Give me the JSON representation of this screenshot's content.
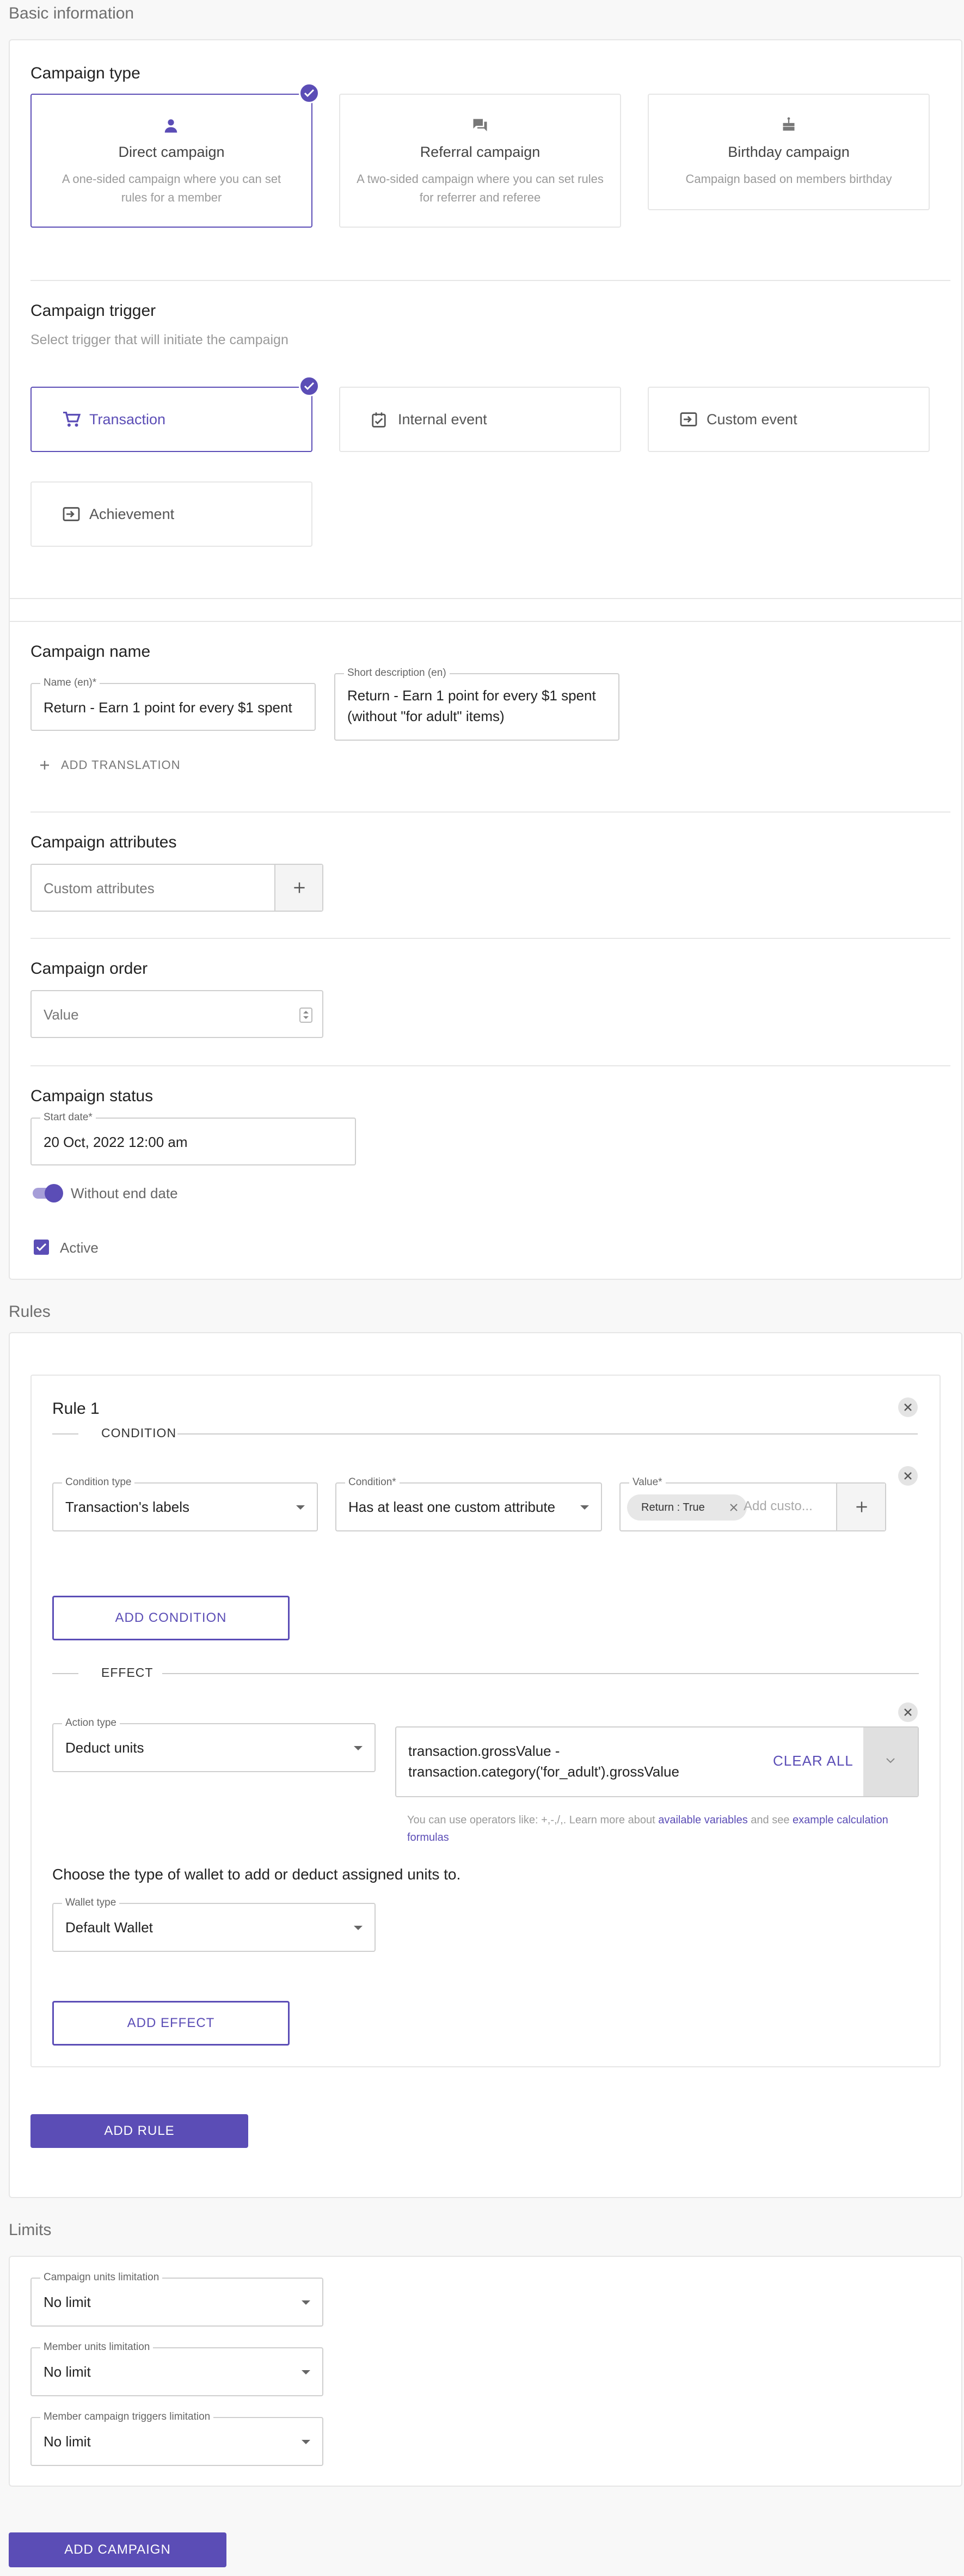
{
  "basic": {
    "section_title": "Basic information",
    "campaign_type": {
      "heading": "Campaign type",
      "options": [
        {
          "title": "Direct campaign",
          "desc": "A one-sided campaign where you can set rules for a member",
          "icon": "person-icon",
          "selected": true
        },
        {
          "title": "Referral campaign",
          "desc": "A two-sided campaign where you can set rules for referrer and referee",
          "icon": "chat-icon",
          "selected": false
        },
        {
          "title": "Birthday campaign",
          "desc": "Campaign based on members birthday",
          "icon": "cake-icon",
          "selected": false
        }
      ]
    },
    "campaign_trigger": {
      "heading": "Campaign trigger",
      "subtitle": "Select trigger that will initiate the campaign",
      "options": [
        {
          "label": "Transaction",
          "icon": "cart-icon",
          "selected": true
        },
        {
          "label": "Internal event",
          "icon": "calendar-check-icon",
          "selected": false
        },
        {
          "label": "Custom event",
          "icon": "input-icon",
          "selected": false
        },
        {
          "label": "Achievement",
          "icon": "input-icon",
          "selected": false
        }
      ]
    },
    "campaign_name": {
      "heading": "Campaign name",
      "name_label": "Name (en)*",
      "name_value": "Return - Earn 1 point for every $1 spent",
      "short_label": "Short description (en)",
      "short_value_line1": "Return - Earn 1 point for every $1 spent",
      "short_value_line2": "(without \"for adult\" items)",
      "add_translation": "ADD TRANSLATION"
    },
    "attributes": {
      "heading": "Campaign attributes",
      "placeholder": "Custom attributes"
    },
    "order": {
      "heading": "Campaign order",
      "placeholder": "Value"
    },
    "status": {
      "heading": "Campaign status",
      "start_label": "Start date*",
      "start_value": "20 Oct, 2022 12:00 am",
      "toggle_label": "Without end date",
      "toggle_on": true,
      "active_label": "Active",
      "active_checked": true
    }
  },
  "rules": {
    "section_title": "Rules",
    "rule": {
      "title": "Rule 1",
      "condition_heading": "CONDITION",
      "condition_type_label": "Condition type",
      "condition_type_value": "Transaction's labels",
      "condition_label": "Condition*",
      "condition_value": "Has at least one custom attribute",
      "value_label": "Value*",
      "value_chip": "Return : True",
      "value_placeholder": "Add custo...",
      "add_condition": "ADD CONDITION",
      "effect_heading": "EFFECT",
      "action_label": "Action type",
      "action_value": "Deduct units",
      "formula_line1": "transaction.grossValue -",
      "formula_line2": "transaction.category('for_adult').grossValue",
      "clear_all": "CLEAR ALL",
      "note_prefix": "You can use operators like: +,-,/,. Learn more about ",
      "note_link1": "available variables",
      "note_mid": " and see ",
      "note_link2_line1": "example calculation",
      "note_link2_line2": "formulas",
      "wallet_prompt": "Choose the type of wallet to add or deduct assigned units to.",
      "wallet_label": "Wallet type",
      "wallet_value": "Default Wallet",
      "add_effect": "ADD EFFECT"
    },
    "add_rule": "ADD RULE"
  },
  "limits": {
    "section_title": "Limits",
    "items": [
      {
        "label": "Campaign units limitation",
        "value": "No limit"
      },
      {
        "label": "Member units limitation",
        "value": "No limit"
      },
      {
        "label": "Member campaign triggers limitation",
        "value": "No limit"
      }
    ]
  },
  "footer": {
    "add_campaign": "ADD CAMPAIGN"
  },
  "colors": {
    "accent": "#5b4db6",
    "border": "#e6e6e6",
    "muted": "#9a9a9a"
  }
}
